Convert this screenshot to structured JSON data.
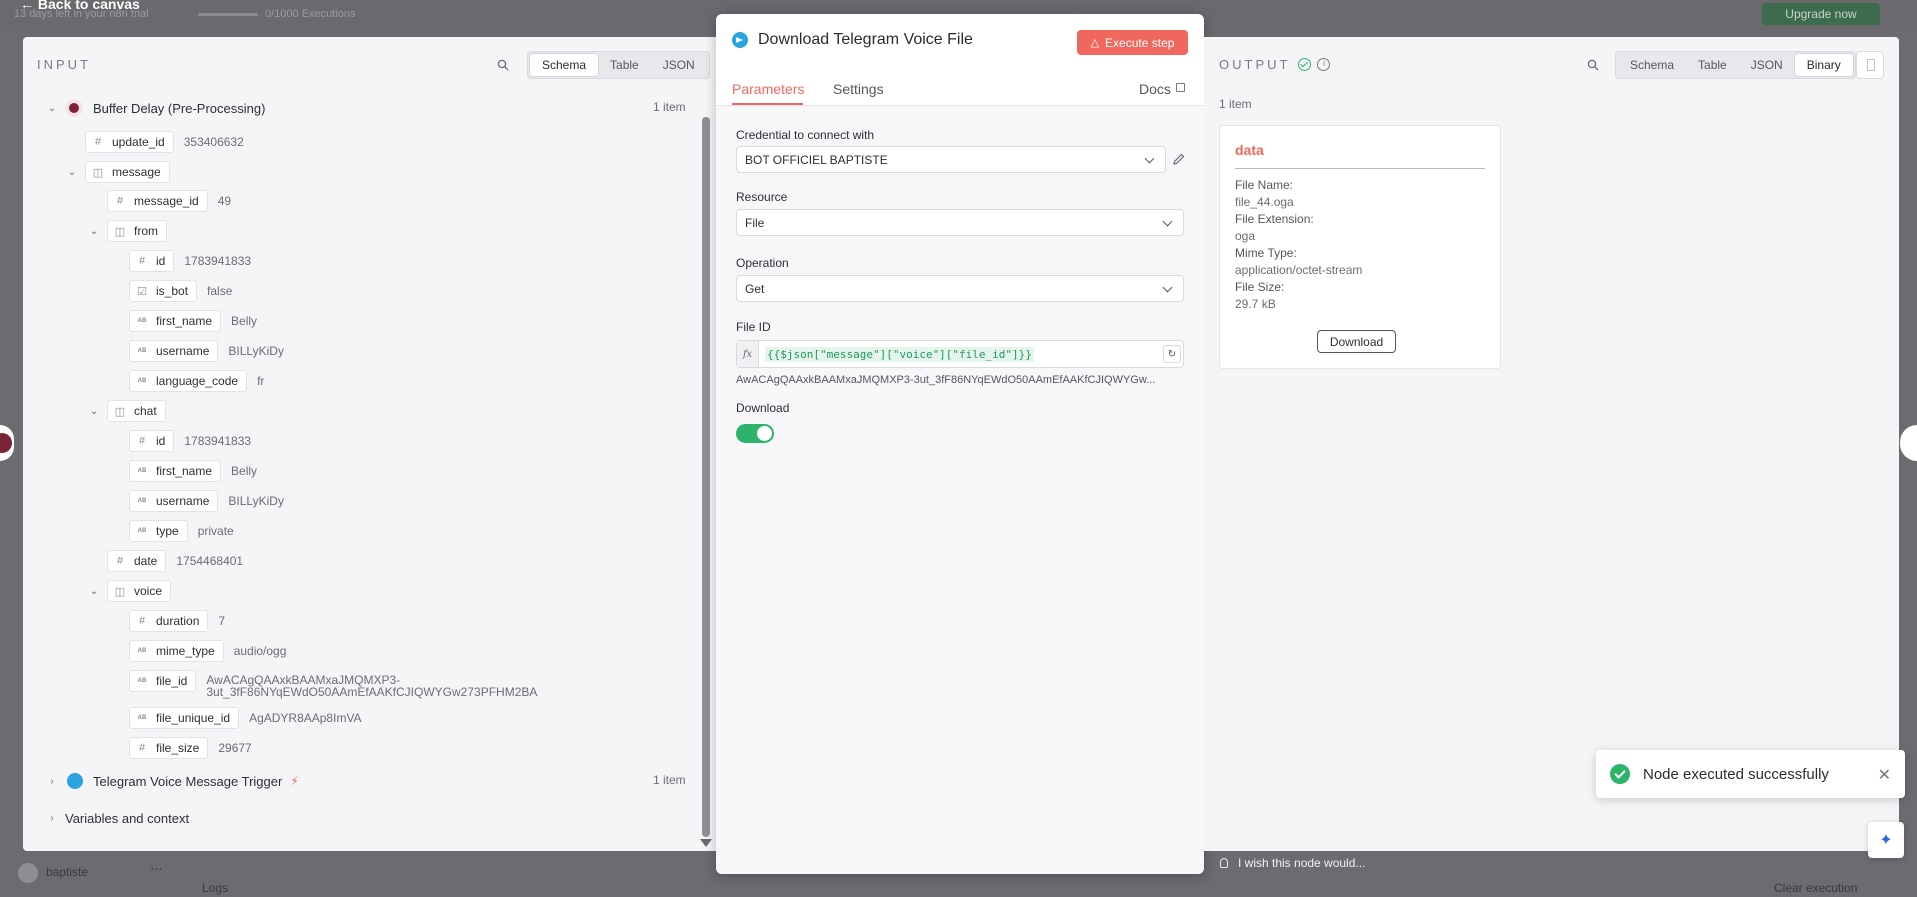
{
  "background": {
    "back_label": "Back to canvas",
    "trial_text": "13 days left in your n8n trial",
    "executions": "0/1000 Executions",
    "upgrade_label": "Upgrade now",
    "user_name": "baptiste",
    "logs_label": "Logs",
    "clear_label": "Clear execution"
  },
  "input": {
    "title": "INPUT",
    "views": [
      "Schema",
      "Table",
      "JSON"
    ],
    "active_view": "Schema",
    "nodes": [
      {
        "name": "Buffer Delay (Pre-Processing)",
        "count": "1 item"
      },
      {
        "name": "Telegram Voice Message Trigger",
        "count": "1 item"
      }
    ],
    "variables_label": "Variables and context",
    "fields": {
      "update_id": {
        "key": "update_id",
        "value": "353406632"
      },
      "message": {
        "key": "message"
      },
      "message_id": {
        "key": "message_id",
        "value": "49"
      },
      "from": {
        "key": "from"
      },
      "from_id": {
        "key": "id",
        "value": "1783941833"
      },
      "is_bot": {
        "key": "is_bot",
        "value": "false"
      },
      "from_first_name": {
        "key": "first_name",
        "value": "Belly"
      },
      "from_username": {
        "key": "username",
        "value": "BILLyKiDy"
      },
      "language_code": {
        "key": "language_code",
        "value": "fr"
      },
      "chat": {
        "key": "chat"
      },
      "chat_id": {
        "key": "id",
        "value": "1783941833"
      },
      "chat_first_name": {
        "key": "first_name",
        "value": "Belly"
      },
      "chat_username": {
        "key": "username",
        "value": "BILLyKiDy"
      },
      "chat_type": {
        "key": "type",
        "value": "private"
      },
      "date": {
        "key": "date",
        "value": "1754468401"
      },
      "voice": {
        "key": "voice"
      },
      "duration": {
        "key": "duration",
        "value": "7"
      },
      "mime_type": {
        "key": "mime_type",
        "value": "audio/ogg"
      },
      "file_id": {
        "key": "file_id",
        "value_line1": "AwACAgQAAxkBAAMxaJMQMXP3-",
        "value_line2": "3ut_3fF86NYqEWdO50AAmEfAAKfCJIQWYGw273PFHM2BA"
      },
      "file_unique_id": {
        "key": "file_unique_id",
        "value": "AgADYR8AAp8ImVA"
      },
      "file_size": {
        "key": "file_size",
        "value": "29677"
      }
    }
  },
  "node": {
    "title": "Download Telegram Voice File",
    "execute_label": "Execute step",
    "tabs": [
      "Parameters",
      "Settings"
    ],
    "docs_label": "Docs",
    "credential_label": "Credential to connect with",
    "credential_value": "BOT OFFICIEL BAPTISTE",
    "resource_label": "Resource",
    "resource_value": "File",
    "operation_label": "Operation",
    "operation_value": "Get",
    "file_id_label": "File ID",
    "fx_label": "fx",
    "file_id_expression": "{{$json[\"message\"][\"voice\"][\"file_id\"]}}",
    "file_id_preview": "AwACAgQAAxkBAAMxaJMQMXP3-3ut_3fF86NYqEWdO50AAmEfAAKfCJIQWYGw...",
    "download_label": "Download",
    "download_enabled": true
  },
  "output": {
    "title": "OUTPUT",
    "views": [
      "Schema",
      "Table",
      "JSON",
      "Binary"
    ],
    "active_view": "Binary",
    "count": "1 item",
    "binary": {
      "heading": "data",
      "file_name_label": "File Name:",
      "file_name": "file_44.oga",
      "file_ext_label": "File Extension:",
      "file_ext": "oga",
      "mime_label": "Mime Type:",
      "mime": "application/octet-stream",
      "size_label": "File Size:",
      "size": "29.7 kB",
      "download_label": "Download"
    }
  },
  "toast": {
    "message": "Node executed successfully"
  },
  "feedback": {
    "text": "I wish this node would..."
  },
  "colors": {
    "accent": "#f0685d",
    "success": "#2cb46b",
    "telegram": "#2aa3df",
    "n8n_node": "#7c2236"
  }
}
